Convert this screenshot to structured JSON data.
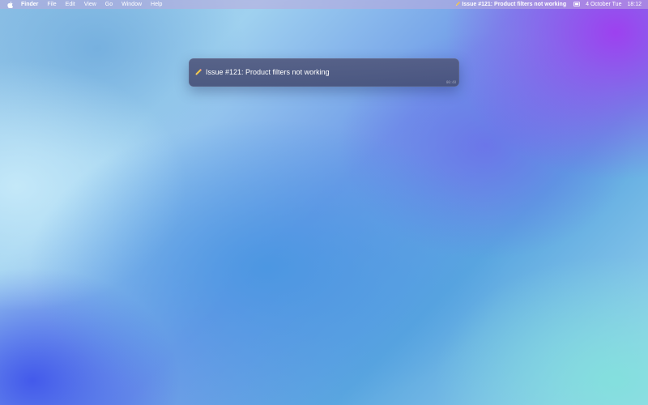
{
  "menubar": {
    "apple_icon": "apple-logo-icon",
    "app_name": "Finder",
    "items": [
      "File",
      "Edit",
      "View",
      "Go",
      "Window",
      "Help"
    ],
    "status_issue": "Issue #121: Product filters not working",
    "status_icon": "pencil-icon",
    "screen_icon": "screen-mirroring-icon",
    "date": "4 October Tue",
    "time": "18:12"
  },
  "panel": {
    "icon": "pencil-icon",
    "title": "Issue #121: Product filters not working",
    "timer": "00:48"
  },
  "colors": {
    "panel_bg": "#525a80",
    "menubar_text": "#ffffff"
  }
}
